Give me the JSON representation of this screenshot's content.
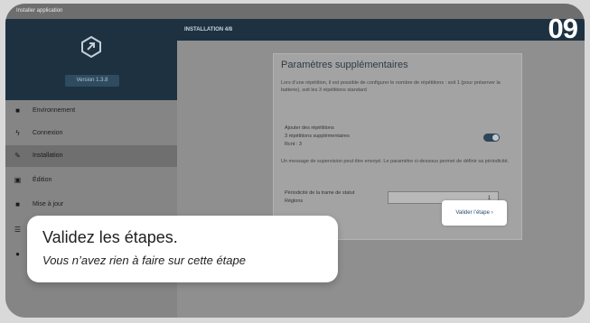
{
  "window": {
    "title": "Installer application"
  },
  "sidebar": {
    "version_label": "Version 1.3.8",
    "items": [
      {
        "label": "Environnement",
        "icon": "grid-icon"
      },
      {
        "label": "Connexion",
        "icon": "plug-icon"
      },
      {
        "label": "Installation",
        "icon": "wrench-icon",
        "active": true
      },
      {
        "label": "Édition",
        "icon": "edit-icon"
      },
      {
        "label": "Mise à jour",
        "icon": "download-icon"
      }
    ]
  },
  "main": {
    "header": "INSTALLATION 4/8",
    "panel": {
      "title": "Paramètres supplémentaires",
      "description": "Lors d’une répétition, il est possible de configurer le nombre de répétitions : soit 1 (pour préserver la batterie), soit les 3 répétitions standard",
      "repeat_label": "Ajouter des répétitions",
      "repeat_sub1": "3 répétitions supplémentaires",
      "repeat_sub2": "Rcnt : 3",
      "supervision_text": "Un message de supervision peut être envoyé. Le paramètre ci-dessous permet de définir sa périodicité.",
      "period_label": "Périodicité de la trame de statut",
      "period_sub": "Réglons",
      "period_value": "1"
    },
    "validate_button": "Valider l’étape ›"
  },
  "badge": "09",
  "callout": {
    "title": "Validez les étapes.",
    "subtitle": "Vous n’avez rien à faire sur cette étape"
  },
  "colors": {
    "header": "#1d3141",
    "accent": "#2d4658"
  }
}
